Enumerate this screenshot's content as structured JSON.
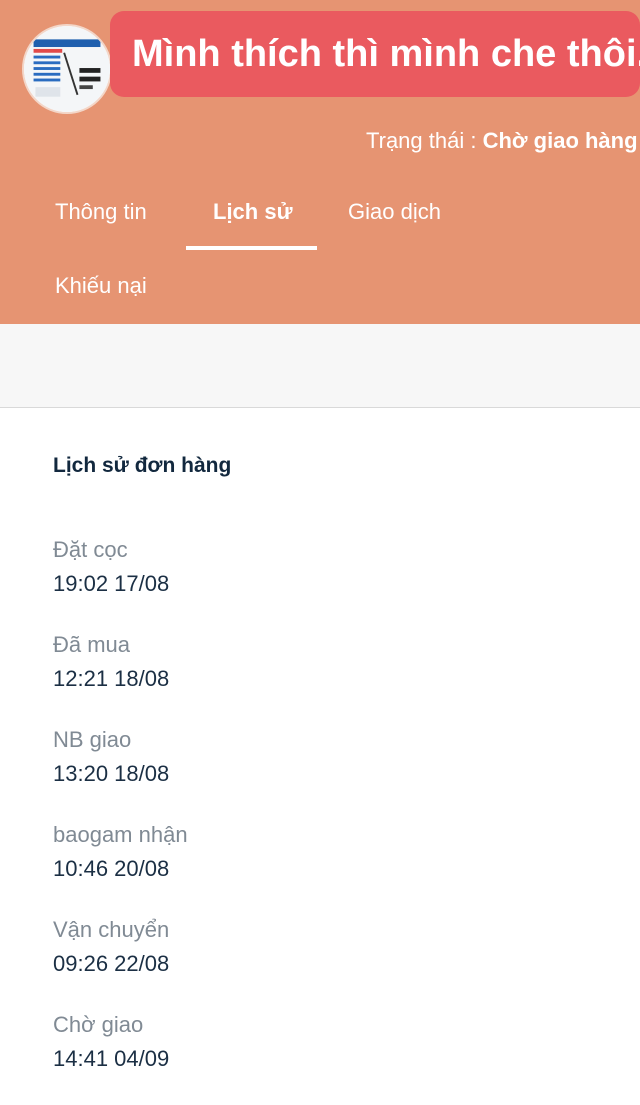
{
  "header": {
    "banner_text": "Mình thích thì mình che thôi.",
    "status_label": "Trạng thái : ",
    "status_value": "Chờ giao hàng"
  },
  "tabs": [
    {
      "label": "Thông tin",
      "active": false
    },
    {
      "label": "Lịch sử",
      "active": true
    },
    {
      "label": "Giao dịch",
      "active": false
    },
    {
      "label": "Khiếu nại",
      "active": false
    }
  ],
  "history": {
    "title": "Lịch sử đơn hàng",
    "events": [
      {
        "label": "Đặt cọc",
        "time": "19:02 17/08"
      },
      {
        "label": "Đã mua",
        "time": "12:21 18/08"
      },
      {
        "label": "NB giao",
        "time": "13:20 18/08"
      },
      {
        "label": "baogam nhận",
        "time": "10:46 20/08"
      },
      {
        "label": "Vận chuyển",
        "time": "09:26 22/08"
      },
      {
        "label": "Chờ giao",
        "time": "14:41 04/09"
      }
    ]
  },
  "colors": {
    "header_bg": "#e69472",
    "banner_bg": "#ea5a5f",
    "title_text": "#12283e",
    "label_text": "#808a94"
  }
}
